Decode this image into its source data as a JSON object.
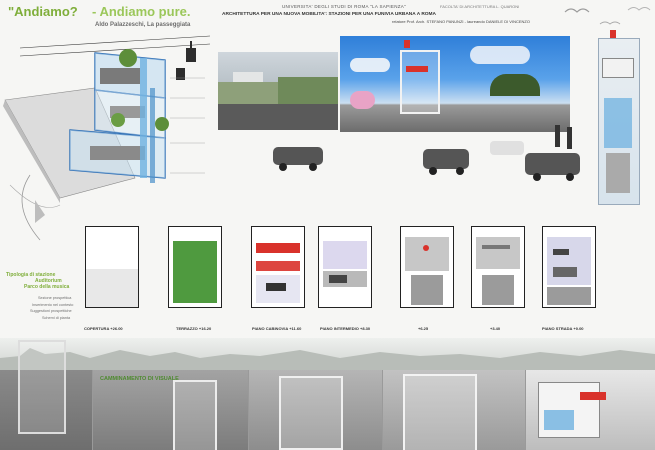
{
  "header": {
    "slogan_left": "\"Andiamo?",
    "slogan_right": "- Andiamo pure.",
    "subtitle": "Aldo Palazzeschi, La passeggiata",
    "university": "UNIVERSITA' DEGLI STUDI DI ROMA \"LA SAPIENZA\"",
    "project_title": "ARCHITETTURA PER UNA NUOVA MOBILITA': STAZIONI PER UNA FUNIVIA URBANA A ROMA",
    "credits": "relatore Prof. Arch. STEFANO PANUNZI - laureando DANIELE DI VINCENZO",
    "faculty": "FACOLTA' DI ARCHITETTURA L. QUARONI"
  },
  "side_notes": {
    "title_lines": [
      "Tipologia di stazione",
      "Auditorium",
      "Parco della musica"
    ],
    "notes": [
      "Sezione prospettica",
      "Inserimento nel contesto",
      "Suggestioni prospettiche",
      "Schemi di pianta"
    ]
  },
  "plans": [
    {
      "label": "COPERTURA +26.00"
    },
    {
      "label": "TERRAZZO +16.20"
    },
    {
      "label": "PIANO CABINOVIA +11.60"
    },
    {
      "label": "PIANO INTERMEDIO +8.30"
    },
    {
      "label": "+6.25"
    },
    {
      "label": "+3.40"
    },
    {
      "label": "PIANO STRADA +0.00"
    }
  ],
  "bottom_strip": {
    "caption": "CAMMINAMENTO DI VISUALE"
  },
  "colors": {
    "accent_green": "#7fae3a",
    "accent_red": "#d9322b",
    "accent_blue": "#6fb2e0",
    "sky_blue": "#2f7fd9"
  }
}
